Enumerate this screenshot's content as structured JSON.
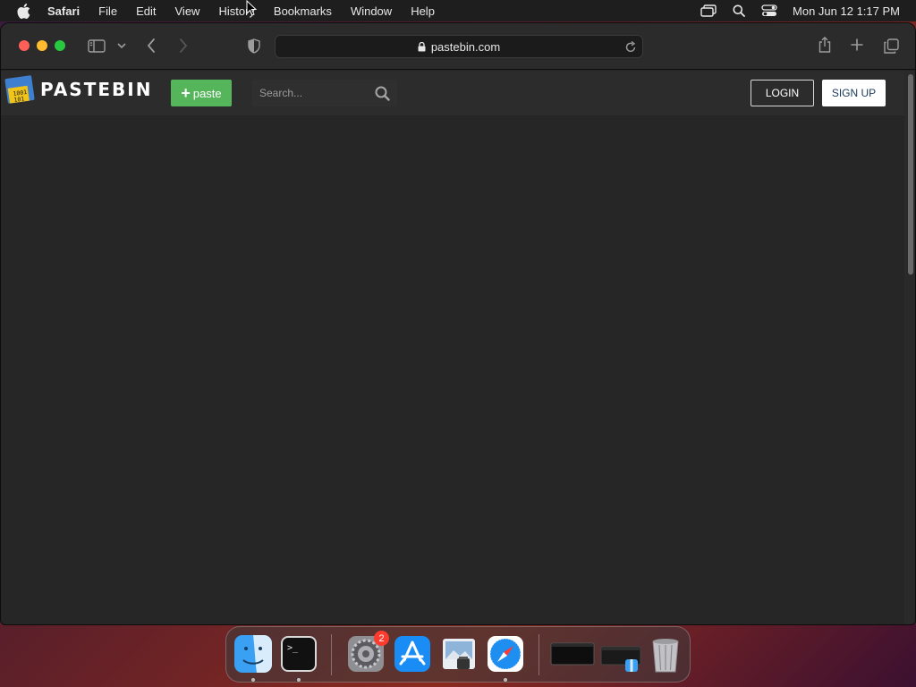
{
  "menubar": {
    "app_name": "Safari",
    "items": [
      "File",
      "Edit",
      "View",
      "History",
      "Bookmarks",
      "Window",
      "Help"
    ],
    "clock": "Mon Jun 12  1:17 PM",
    "status_icons": [
      "screen-mirroring-icon",
      "spotlight-search-icon",
      "control-center-icon"
    ]
  },
  "browser": {
    "url": "pastebin.com",
    "toolbar_icons": [
      "sidebar-icon",
      "chevron-down-icon",
      "back-icon",
      "forward-icon",
      "privacy-shield-icon",
      "share-icon",
      "new-tab-icon",
      "tab-overview-icon"
    ]
  },
  "site": {
    "logo_text": "PASTEBIN",
    "paste_button": "paste",
    "search_placeholder": "Search...",
    "login": "LOGIN",
    "signup": "SIGN UP"
  },
  "dock": {
    "apps": [
      {
        "name": "Finder",
        "icon": "finder-icon"
      },
      {
        "name": "Terminal",
        "icon": "terminal-icon"
      },
      {
        "name": "System Preferences",
        "icon": "system-preferences-icon",
        "badge": "2"
      },
      {
        "name": "App Store",
        "icon": "app-store-icon"
      },
      {
        "name": "Preview",
        "icon": "preview-icon"
      },
      {
        "name": "Safari",
        "icon": "safari-icon"
      },
      {
        "name": "Window",
        "icon": "window-icon"
      },
      {
        "name": "Finder window",
        "icon": "finder-window-icon"
      },
      {
        "name": "Trash",
        "icon": "trash-icon"
      }
    ]
  },
  "colors": {
    "paste_green": "#55b55b",
    "page_bg": "#262626",
    "header_bg": "#2c2c2c"
  }
}
